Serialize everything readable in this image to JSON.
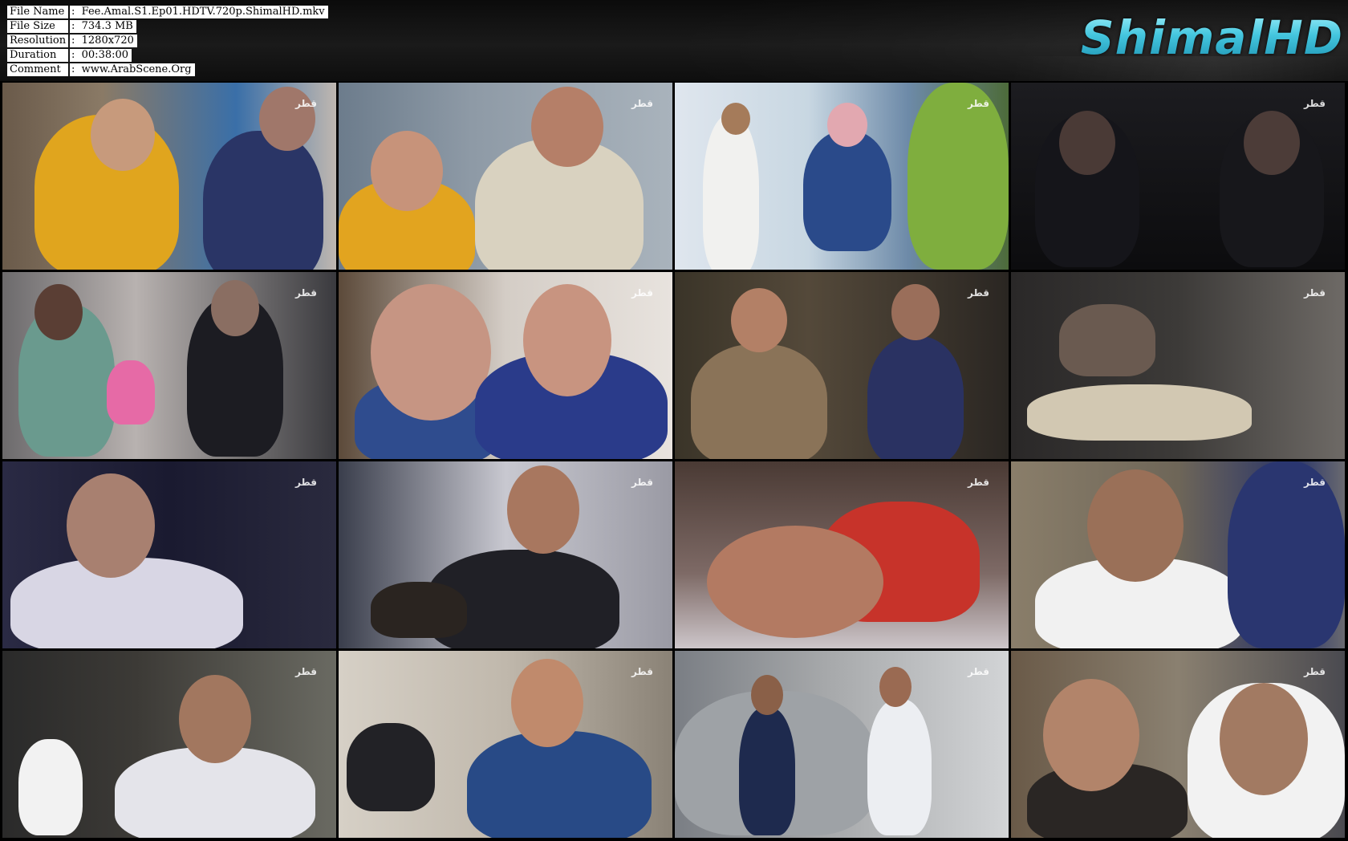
{
  "info": [
    {
      "label": "File Name",
      "value": ":  Fee.Amal.S1.Ep01.HDTV.720p.ShimalHD.mkv"
    },
    {
      "label": "File Size",
      "value": ":  734.3 MB"
    },
    {
      "label": "Resolution",
      "value": ":  1280x720"
    },
    {
      "label": "Duration",
      "value": ":  00:38:00"
    },
    {
      "label": "Comment",
      "value": ":  www.ArabScene.Org"
    }
  ],
  "logo": "ShimalHD",
  "watermark": "قطر",
  "thumbnails": [
    {
      "scene": "woman-yellow-dress-reading"
    },
    {
      "scene": "two-women-talking-sofa"
    },
    {
      "scene": "supermarket-aisle"
    },
    {
      "scene": "car-interior-night"
    },
    {
      "scene": "bedroom-two-women"
    },
    {
      "scene": "two-women-close-up"
    },
    {
      "scene": "two-women-hallway"
    },
    {
      "scene": "hand-writing-notebook"
    },
    {
      "scene": "bald-man-night"
    },
    {
      "scene": "young-man-writing"
    },
    {
      "scene": "woman-sleeping"
    },
    {
      "scene": "elderly-man-chair"
    },
    {
      "scene": "woman-striped-shirt-kitchen"
    },
    {
      "scene": "woman-office-desk"
    },
    {
      "scene": "two-men-by-car"
    },
    {
      "scene": "woman-and-man-close-up"
    }
  ],
  "colors": {
    "logo": "#44c6de",
    "background": "#000000"
  }
}
